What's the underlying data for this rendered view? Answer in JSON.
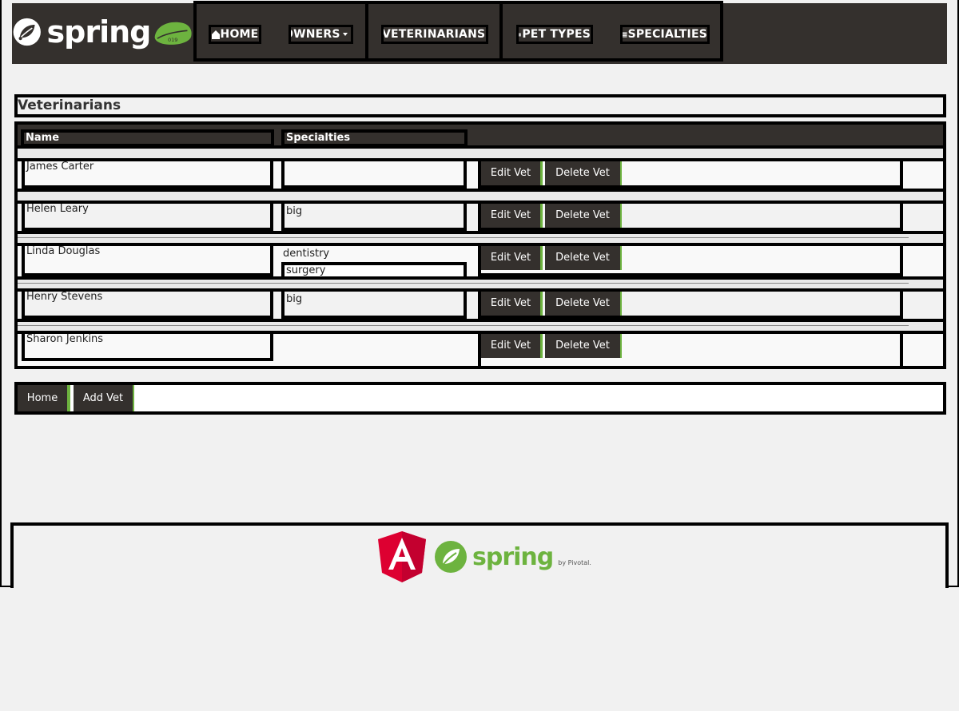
{
  "brand": {
    "name": "spring",
    "icon": "spring-leaf-logo",
    "badge": "019"
  },
  "nav": {
    "home": "HOME",
    "owners": "OWNERS",
    "veterinarians": "VETERINARIANS",
    "pet_types": "PET TYPES",
    "specialties": "SPECIALTIES"
  },
  "page": {
    "title": "Veterinarians"
  },
  "table": {
    "headers": {
      "name": "Name",
      "specialties": "Specialties"
    },
    "rows": [
      {
        "name": "James Carter",
        "specialties": [],
        "edit": "Edit Vet",
        "delete": "Delete Vet"
      },
      {
        "name": "Helen Leary",
        "specialties": [
          "big"
        ],
        "edit": "Edit Vet",
        "delete": "Delete Vet"
      },
      {
        "name": "Linda Douglas",
        "specialties": [
          "dentistry",
          "surgery"
        ],
        "edit": "Edit Vet",
        "delete": "Delete Vet"
      },
      {
        "name": "Henry Stevens",
        "specialties": [
          "big"
        ],
        "edit": "Edit Vet",
        "delete": "Delete Vet"
      },
      {
        "name": "Sharon Jenkins",
        "specialties": [],
        "edit": "Edit Vet",
        "delete": "Delete Vet"
      }
    ]
  },
  "actions": {
    "home": "Home",
    "add_vet": "Add Vet"
  },
  "footer": {
    "spring": "spring",
    "pivotal": "by Pivotal.",
    "angular_icon": "angular-logo"
  },
  "colors": {
    "dark": "#34302d",
    "accent": "#6db33f",
    "angular": "#dd0031"
  }
}
